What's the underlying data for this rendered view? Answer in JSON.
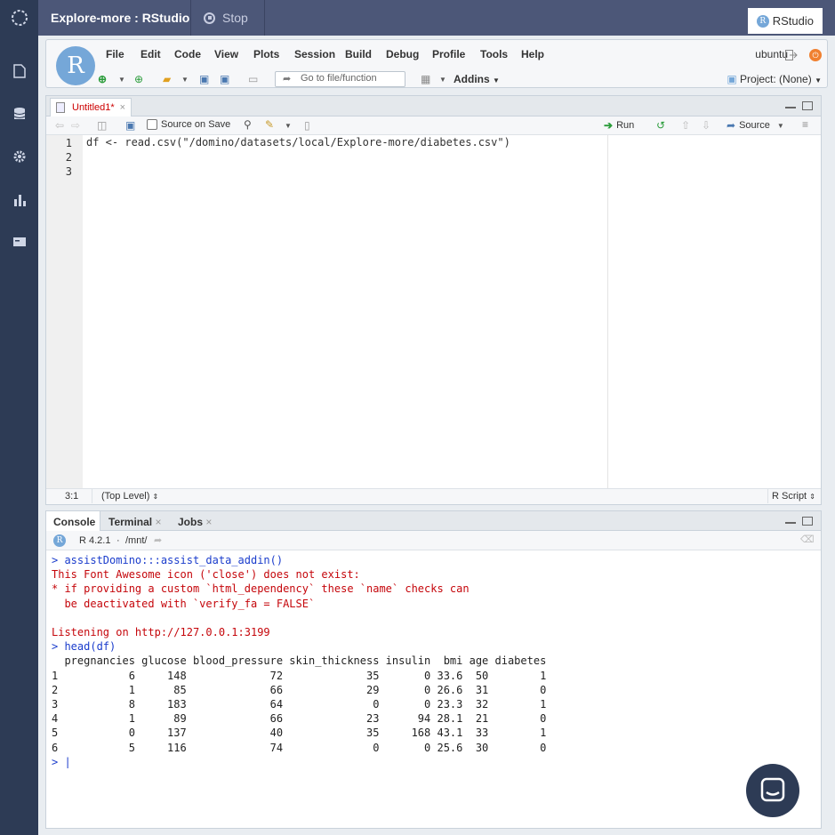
{
  "colors": {
    "sidebar": "#2d3b55",
    "topbar": "#4c5778",
    "command": "#1a3ccc",
    "error": "#c5060b"
  },
  "sidebar": {
    "icons": [
      "domino-logo-icon",
      "file-icon",
      "database-icon",
      "gear-icon",
      "bar-chart-icon",
      "credit-card-icon"
    ]
  },
  "topbar": {
    "title": "Explore-more : RStudio",
    "stop_label": "Stop",
    "rstudio_label": "RStudio"
  },
  "menubar": {
    "items": [
      "File",
      "Edit",
      "Code",
      "View",
      "Plots",
      "Session",
      "Build",
      "Debug",
      "Profile",
      "Tools",
      "Help"
    ],
    "user": "ubuntu",
    "goto_placeholder": "Go to file/function",
    "addins_label": "Addins",
    "project_label": "Project: (None)"
  },
  "source": {
    "tab_label": "Untitled1*",
    "source_on_save_label": "Source on Save",
    "run_label": "Run",
    "source_label": "Source",
    "line_numbers": [
      "1",
      "2",
      "3"
    ],
    "code_line_1": "df <- read.csv(\"/domino/datasets/local/Explore-more/diabetes.csv\")",
    "cursor_position": "3:1",
    "scope": "(Top Level)",
    "file_type": "R Script"
  },
  "console": {
    "tabs": [
      "Console",
      "Terminal",
      "Jobs"
    ],
    "r_version": "R 4.2.1",
    "path": "/mnt/",
    "lines": [
      {
        "kind": "cmd",
        "text": "> assistDomino:::assist_data_addin()"
      },
      {
        "kind": "err",
        "text": "This Font Awesome icon ('close') does not exist:"
      },
      {
        "kind": "err",
        "text": "* if providing a custom `html_dependency` these `name` checks can"
      },
      {
        "kind": "err",
        "text": "  be deactivated with `verify_fa = FALSE`"
      },
      {
        "kind": "err",
        "text": ""
      },
      {
        "kind": "err",
        "text": "Listening on http://127.0.0.1:3199"
      },
      {
        "kind": "cmd",
        "text": "> head(df)"
      },
      {
        "kind": "out",
        "text": "  pregnancies glucose blood_pressure skin_thickness insulin  bmi age diabetes"
      },
      {
        "kind": "out",
        "text": "1           6     148             72             35       0 33.6  50        1"
      },
      {
        "kind": "out",
        "text": "2           1      85             66             29       0 26.6  31        0"
      },
      {
        "kind": "out",
        "text": "3           8     183             64              0       0 23.3  32        1"
      },
      {
        "kind": "out",
        "text": "4           1      89             66             23      94 28.1  21        0"
      },
      {
        "kind": "out",
        "text": "5           0     137             40             35     168 43.1  33        1"
      },
      {
        "kind": "out",
        "text": "6           5     116             74              0       0 25.6  30        0"
      },
      {
        "kind": "cmd",
        "text": "> |"
      }
    ]
  }
}
